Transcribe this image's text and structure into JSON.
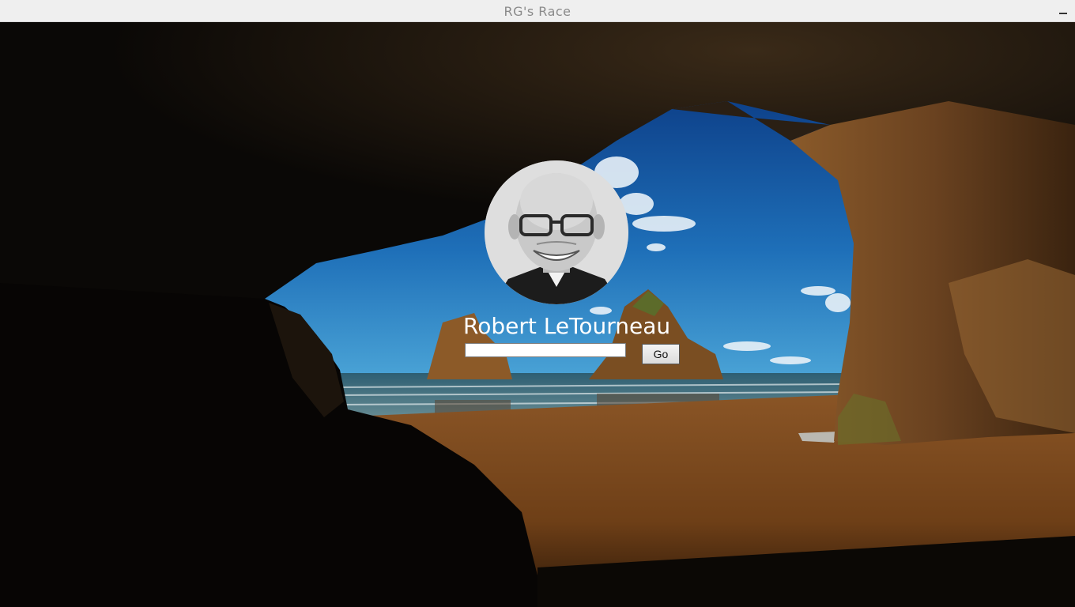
{
  "window": {
    "title": "RG's Race",
    "minimize_icon": "minimize-icon"
  },
  "login": {
    "user_name": "Robert LeTourneau",
    "password_value": "",
    "go_label": "Go"
  },
  "background": {
    "description_icon": "cave-beach-wallpaper"
  },
  "colors": {
    "titlebar": "#efefef",
    "title_text": "#8a8a8a",
    "name_text": "#ffffff"
  }
}
